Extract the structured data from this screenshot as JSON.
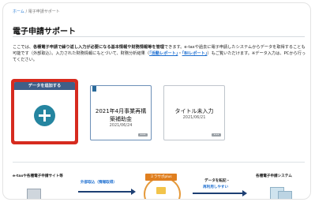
{
  "breadcrumb": {
    "home": "ホーム",
    "sep": "/",
    "current": "電子申請サポート"
  },
  "page_title": "電子申請サポート",
  "description": {
    "p1": "ここでは、",
    "bold1": "各種電子申請で繰り返し入力が必要になる基本情報や財務情報等を管理",
    "p2": "できます。e-taxや過去に電子申請したシステムからデータを取得することも可能です（外部取込）。入力された財務情報にもとづいて、財務分析結果（",
    "link1": "「活動レポート」",
    "p3": "・",
    "link2": "「BIレポート」",
    "p4": "）もご覧いただけます。※データ入力は、PCから行ってください。"
  },
  "add_card": {
    "label": "データを追加する"
  },
  "cards": [
    {
      "name": "2021年4月事業再構築補助金",
      "date": "2021/06/24",
      "more": "•••"
    },
    {
      "name": "タイトル未入力",
      "date": "2021/06/21",
      "more": "•••"
    }
  ],
  "flow": {
    "left_label": "e-taxや各種電子申請サイト等",
    "import_label": "外部取込（情報取得）",
    "center_tag": "ミラサポplus",
    "transfer_label": "データを転記・",
    "reuse_label": "再利用しやすい",
    "right_label": "各種電子申請システム"
  },
  "colors": {
    "highlight": "#d62b1f",
    "header": "#3f5f88",
    "accent": "#2585a0",
    "orange": "#e07f1f"
  }
}
